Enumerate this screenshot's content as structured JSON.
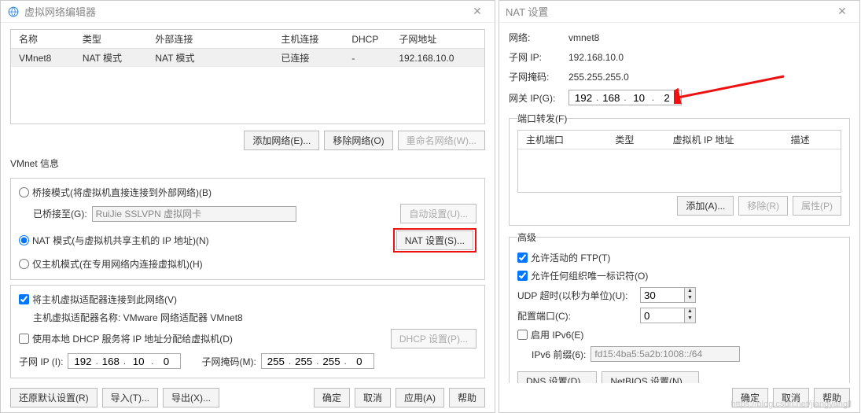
{
  "left": {
    "title": "虚拟网络编辑器",
    "columns": [
      "名称",
      "类型",
      "外部连接",
      "主机连接",
      "DHCP",
      "子网地址"
    ],
    "rows": [
      {
        "name": "VMnet8",
        "type": "NAT 模式",
        "ext": "NAT 模式",
        "host": "已连接",
        "dhcp": "-",
        "subnet": "192.168.10.0"
      }
    ],
    "btnAdd": "添加网络(E)...",
    "btnRemove": "移除网络(O)",
    "btnRename": "重命名网络(W)...",
    "vmnetInfoTitle": "VMnet 信息",
    "radioBridged": "桥接模式(将虚拟机直接连接到外部网络)(B)",
    "bridgedToLabel": "已桥接至(G):",
    "bridgedToValue": "RuiJie SSLVPN 虚拟网卡",
    "btnAuto": "自动设置(U)...",
    "radioNAT": "NAT 模式(与虚拟机共享主机的 IP 地址)(N)",
    "btnNATSettings": "NAT 设置(S)...",
    "radioHostOnly": "仅主机模式(在专用网络内连接虚拟机)(H)",
    "chkHostAdapter": "将主机虚拟适配器连接到此网络(V)",
    "hostAdapterNameLabel": "主机虚拟适配器名称: VMware 网络适配器 VMnet8",
    "chkLocalDHCP": "使用本地 DHCP 服务将 IP 地址分配给虚拟机(D)",
    "btnDHCPSettings": "DHCP 设置(P)...",
    "subnetIPLabel": "子网 IP (I):",
    "subnetIPValue": [
      "192",
      "168",
      "10",
      "0"
    ],
    "subnetMaskLabel": "子网掩码(M):",
    "subnetMaskValue": [
      "255",
      "255",
      "255",
      "0"
    ],
    "btnRestore": "还原默认设置(R)",
    "btnImport": "导入(T)...",
    "btnExport": "导出(X)...",
    "btnOK": "确定",
    "btnCancel": "取消",
    "btnApply": "应用(A)",
    "btnHelp": "帮助"
  },
  "right": {
    "title": "NAT 设置",
    "networkLabel": "网络:",
    "networkValue": "vmnet8",
    "subnetIPLabel": "子网 IP:",
    "subnetIPValue": "192.168.10.0",
    "subnetMaskLabel": "子网掩码:",
    "subnetMaskValue": "255.255.255.0",
    "gatewayLabel": "网关 IP(G):",
    "gatewayValue": [
      "192",
      "168",
      "10",
      "2"
    ],
    "portForwardTitle": "端口转发(F)",
    "pfColumns": [
      "主机端口",
      "类型",
      "虚拟机 IP 地址",
      "描述"
    ],
    "btnPFAdd": "添加(A)...",
    "btnPFRemove": "移除(R)",
    "btnPFProps": "属性(P)",
    "advTitle": "高级",
    "chkActiveFTP": "允许活动的 FTP(T)",
    "chkAnyOUI": "允许任何组织唯一标识符(O)",
    "udpTimeoutLabel": "UDP 超时(以秒为单位)(U):",
    "udpTimeoutValue": "30",
    "configPortLabel": "配置端口(C):",
    "configPortValue": "0",
    "chkIPv6": "启用 IPv6(E)",
    "ipv6PrefixLabel": "IPv6 前缀(6):",
    "ipv6PrefixValue": "fd15:4ba5:5a2b:1008::/64",
    "btnDNS": "DNS 设置(D)...",
    "btnNetBIOS": "NetBIOS 设置(N)...",
    "btnOK": "确定",
    "btnCancel": "取消",
    "btnHelp": "帮助",
    "watermark": "https://blog.csdn.net/jiangyangll"
  }
}
